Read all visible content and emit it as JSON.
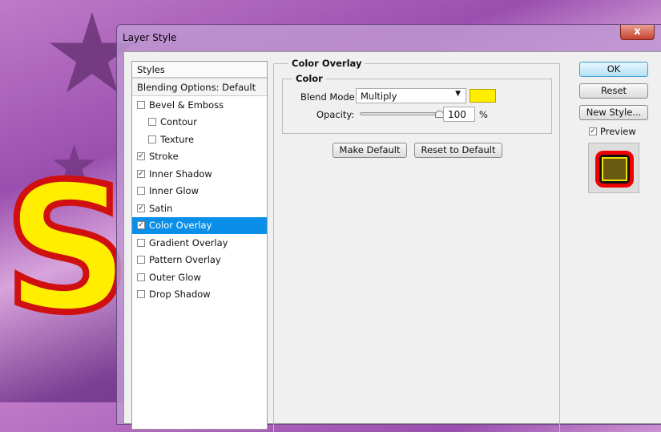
{
  "dialog": {
    "title": "Layer Style",
    "close_label": "x"
  },
  "styles": {
    "header": "Styles",
    "blending": "Blending Options: Default",
    "items": [
      {
        "label": "Bevel & Emboss",
        "checked": false,
        "sub": false
      },
      {
        "label": "Contour",
        "checked": false,
        "sub": true
      },
      {
        "label": "Texture",
        "checked": false,
        "sub": true
      },
      {
        "label": "Stroke",
        "checked": true,
        "sub": false
      },
      {
        "label": "Inner Shadow",
        "checked": true,
        "sub": false
      },
      {
        "label": "Inner Glow",
        "checked": false,
        "sub": false
      },
      {
        "label": "Satin",
        "checked": true,
        "sub": false
      },
      {
        "label": "Color Overlay",
        "checked": true,
        "sub": false,
        "selected": true
      },
      {
        "label": "Gradient Overlay",
        "checked": false,
        "sub": false
      },
      {
        "label": "Pattern Overlay",
        "checked": false,
        "sub": false
      },
      {
        "label": "Outer Glow",
        "checked": false,
        "sub": false
      },
      {
        "label": "Drop Shadow",
        "checked": false,
        "sub": false
      }
    ]
  },
  "overlay": {
    "title": "Color Overlay",
    "group": "Color",
    "blend_label": "Blend Mode:",
    "blend_value": "Multiply",
    "color": "#ffee00",
    "opacity_label": "Opacity:",
    "opacity_value": "100",
    "opacity_unit": "%",
    "opacity_percent": 100,
    "make_default": "Make Default",
    "reset_default": "Reset to Default"
  },
  "buttons": {
    "ok": "OK",
    "reset": "Reset",
    "new_style": "New Style...",
    "preview": "Preview",
    "preview_checked": true
  }
}
